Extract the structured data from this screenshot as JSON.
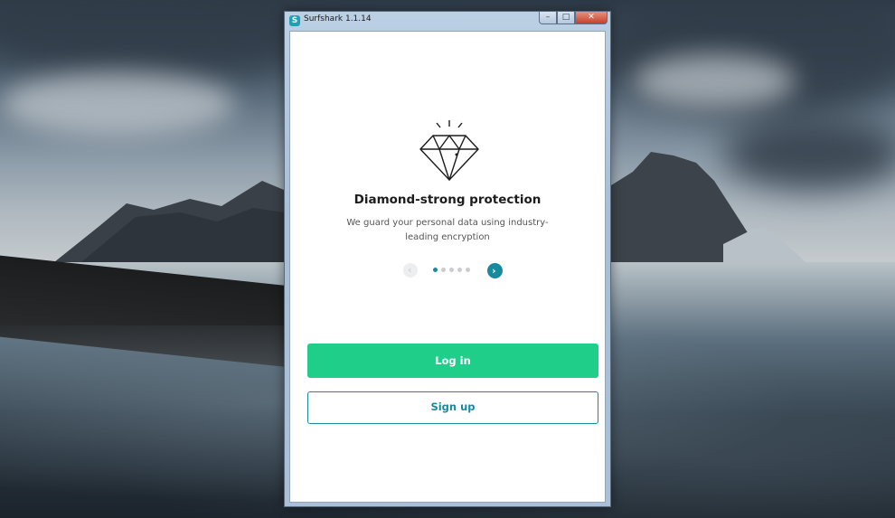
{
  "window": {
    "title": "Surfshark 1.1.14",
    "logo_glyph": "S",
    "controls": {
      "minimize": "–",
      "maximize": "□",
      "close": "✕"
    }
  },
  "onboarding": {
    "icon": "diamond-icon",
    "headline": "Diamond-strong protection",
    "description": "We guard your personal data using industry-leading encryption",
    "carousel": {
      "total_slides": 5,
      "current_slide": 1,
      "prev_glyph": "‹",
      "next_glyph": "›"
    }
  },
  "actions": {
    "login_label": "Log in",
    "signup_label": "Sign up"
  },
  "colors": {
    "accent": "#178a9e",
    "login_green": "#1fcf89",
    "dot_inactive": "#c9cccf"
  }
}
